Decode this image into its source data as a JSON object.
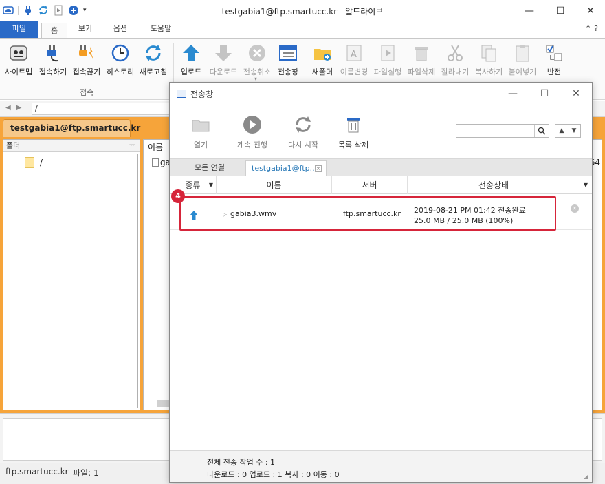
{
  "window": {
    "title": "testgabia1@ftp.smartucc.kr - 알드라이브",
    "minimize": "—",
    "maximize": "☐",
    "close": "✕"
  },
  "ribbon_tabs": {
    "file": "파일",
    "home": "홈",
    "view": "보기",
    "options": "옵션",
    "help": "도움말",
    "right_controls": "⌃?"
  },
  "ribbon": {
    "buttons": [
      {
        "label": "사이트맵",
        "icon": "sitemap-icon"
      },
      {
        "label": "접속하기",
        "icon": "plug-connect-icon"
      },
      {
        "label": "접속끊기",
        "icon": "plug-disconnect-icon"
      },
      {
        "label": "히스토리",
        "icon": "clock-icon"
      },
      {
        "label": "새로고침",
        "icon": "refresh-icon"
      },
      {
        "label": "업로드",
        "icon": "upload-arrow-icon"
      },
      {
        "label": "다운로드",
        "icon": "download-arrow-icon"
      },
      {
        "label": "전송취소",
        "icon": "cancel-circle-icon"
      },
      {
        "label": "전송창",
        "icon": "transfer-window-icon"
      },
      {
        "label": "새폴더",
        "icon": "new-folder-icon"
      },
      {
        "label": "이름변경",
        "icon": "rename-icon"
      },
      {
        "label": "파일실행",
        "icon": "run-file-icon"
      },
      {
        "label": "파일삭제",
        "icon": "trash-icon"
      },
      {
        "label": "잘라내기",
        "icon": "scissors-icon"
      },
      {
        "label": "복사하기",
        "icon": "copy-icon"
      },
      {
        "label": "붙여넣기",
        "icon": "paste-icon"
      },
      {
        "label": "반전",
        "icon": "invert-selection-icon"
      }
    ],
    "group_label": "접속"
  },
  "address": {
    "path": "/"
  },
  "session": {
    "tab_label": "testgabia1@ftp.smartucc.kr",
    "folder_pane_title": "폴더",
    "pin": "ᅲ",
    "folder_name": "/",
    "file_pane_header": "이름",
    "file_row_partial": "ga",
    "column_partial": "64"
  },
  "statusbar": {
    "server": "ftp.smartucc.kr",
    "files": "파일: 1"
  },
  "transfer": {
    "title": "전송창",
    "toolbar": {
      "open": "열기",
      "resume": "계속 진행",
      "restart": "다시 시작",
      "clear_list": "목록 삭제"
    },
    "search_placeholder": "",
    "tabs": {
      "all": "모든 연결",
      "session": "testgabia1@ftp..."
    },
    "columns": {
      "kind": "종류",
      "name": "이름",
      "server": "서버",
      "status": "전송상태"
    },
    "rows": [
      {
        "name": "gabia3.wmv",
        "server": "ftp.smartucc.kr",
        "status_line1": "2019-08-21 PM 01:42 전송완료",
        "status_line2": "25.0 MB / 25.0 MB (100%)"
      }
    ],
    "badge": "4",
    "footer": {
      "total": "전체 전송 작업 수 : 1",
      "detail": "다운로드 : 0  업로드 : 1  복사 : 0  이동 : 0"
    }
  },
  "colors": {
    "accent_blue": "#2a6ac7",
    "session_orange": "#f6a43a",
    "highlight_red": "#d6253a"
  }
}
